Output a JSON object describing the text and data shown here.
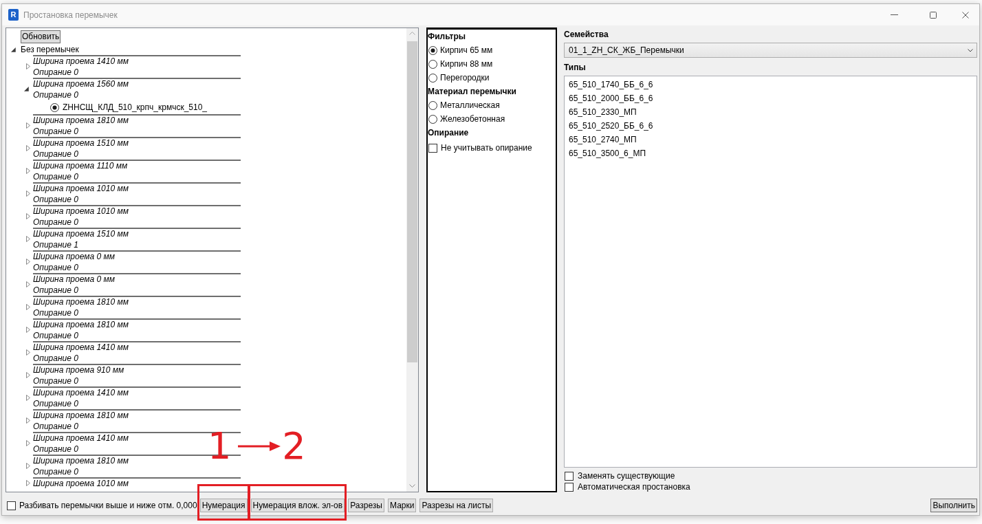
{
  "window": {
    "logo_letter": "R",
    "title": "Простановка перемычек"
  },
  "tree": {
    "refresh_button": "Обновить",
    "root": {
      "label": "Без перемычек",
      "expanded": true,
      "children": [
        {
          "title": "Ширина проема 1410 мм",
          "subtitle": "Опирание 0",
          "expanded": false
        },
        {
          "title": "Ширина проема 1560 мм",
          "subtitle": "Опирание 0",
          "expanded": true,
          "children": [
            {
              "label": "ZHНСЩ_КЛД_510_крпч_крмчск_510_",
              "selected": true
            }
          ]
        },
        {
          "title": "Ширина проема 1810 мм",
          "subtitle": "Опирание 0",
          "expanded": false
        },
        {
          "title": "Ширина проема 1510 мм",
          "subtitle": "Опирание 0",
          "expanded": false
        },
        {
          "title": "Ширина проема 1110 мм",
          "subtitle": "Опирание 0",
          "expanded": false
        },
        {
          "title": "Ширина проема 1010 мм",
          "subtitle": "Опирание 0",
          "expanded": false
        },
        {
          "title": "Ширина проема 1010 мм",
          "subtitle": "Опирание 0",
          "expanded": false
        },
        {
          "title": "Ширина проема 1510 мм",
          "subtitle": "Опирание 1",
          "expanded": false
        },
        {
          "title": "Ширина проема 0 мм",
          "subtitle": "Опирание 0",
          "expanded": false
        },
        {
          "title": "Ширина проема 0 мм",
          "subtitle": "Опирание 0",
          "expanded": false
        },
        {
          "title": "Ширина проема 1810 мм",
          "subtitle": "Опирание 0",
          "expanded": false
        },
        {
          "title": "Ширина проема 1810 мм",
          "subtitle": "Опирание 0",
          "expanded": false
        },
        {
          "title": "Ширина проема 1410 мм",
          "subtitle": "Опирание 0",
          "expanded": false
        },
        {
          "title": "Ширина проема 910 мм",
          "subtitle": "Опирание 0",
          "expanded": false
        },
        {
          "title": "Ширина проема 1410 мм",
          "subtitle": "Опирание 0",
          "expanded": false
        },
        {
          "title": "Ширина проема 1810 мм",
          "subtitle": "Опирание 0",
          "expanded": false
        },
        {
          "title": "Ширина проема 1410 мм",
          "subtitle": "Опирание 0",
          "expanded": false
        },
        {
          "title": "Ширина проема 1810 мм",
          "subtitle": "Опирание 0",
          "expanded": false
        },
        {
          "title": "Ширина проема 1010 мм",
          "expanded": false
        }
      ]
    }
  },
  "filters": {
    "sections": [
      {
        "heading": "Фильтры",
        "options": [
          {
            "kind": "radio",
            "label": "Кирпич 65 мм",
            "selected": true
          },
          {
            "kind": "radio",
            "label": "Кирпич 88 мм",
            "selected": false
          },
          {
            "kind": "radio",
            "label": "Перегородки",
            "selected": false
          }
        ]
      },
      {
        "heading": "Материал перемычки",
        "options": [
          {
            "kind": "radio",
            "label": "Металлическая",
            "selected": false
          },
          {
            "kind": "radio",
            "label": "Железобетонная",
            "selected": false
          }
        ]
      },
      {
        "heading": "Опирание",
        "options": [
          {
            "kind": "checkbox",
            "label": "Не учитывать опирание",
            "checked": false
          }
        ]
      }
    ]
  },
  "families": {
    "label": "Семейства",
    "value": "01_1_ZH_СК_ЖБ_Перемычки"
  },
  "types": {
    "label": "Типы",
    "items": [
      {
        "label": "65_510_1740_ББ_6_6",
        "selected": false
      },
      {
        "label": "65_510_2000_ББ_6_6",
        "selected": false
      },
      {
        "label": "65_510_2330_МП",
        "selected": false
      },
      {
        "label": "65_510_2520_ББ_6_6",
        "selected": false
      },
      {
        "label": "65_510_2740_МП",
        "selected": false
      },
      {
        "label": "65_510_3500_6_МП",
        "selected": false
      }
    ]
  },
  "options": [
    {
      "label": "Заменять существующие",
      "checked": false
    },
    {
      "label": "Автоматическая простановка",
      "checked": false
    }
  ],
  "bottom_bar": {
    "split_option": {
      "label": "Разбивать перемычки выше и ниже отм. 0,000",
      "checked": false
    },
    "buttons": [
      {
        "label": "Нумерация",
        "highlighted": true
      },
      {
        "label": "Нумерация влож. эл-ов",
        "highlighted": true
      },
      {
        "label": "Разрезы",
        "highlighted": false
      },
      {
        "label": "Марки",
        "highlighted": false
      },
      {
        "label": "Разрезы на листы",
        "highlighted": false
      }
    ],
    "run_button": "Выполнить"
  },
  "annotation": {
    "start_label": "1",
    "end_label": "2"
  }
}
